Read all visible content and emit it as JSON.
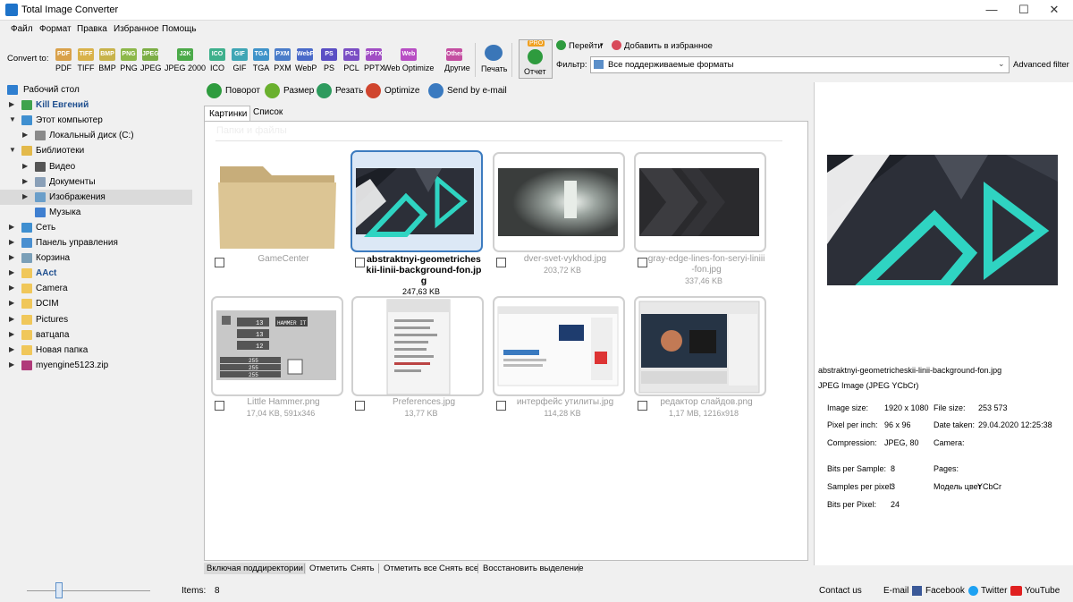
{
  "window": {
    "title": "Total Image Converter",
    "minimize": "—",
    "maximize": "☐",
    "close": "✕"
  },
  "menu": [
    "Файл",
    "Формат",
    "Правка",
    "Избранное",
    "Помощь"
  ],
  "toolbar": {
    "convert_to": "Convert to:",
    "formats": [
      {
        "label": "PDF",
        "icon": "PDF",
        "color": "#d9a14a"
      },
      {
        "label": "TIFF",
        "icon": "TIFF",
        "color": "#d9b24a"
      },
      {
        "label": "BMP",
        "icon": "BMP",
        "color": "#c8b34a"
      },
      {
        "label": "PNG",
        "icon": "PNG",
        "color": "#8db84a"
      },
      {
        "label": "JPEG",
        "icon": "JPEG",
        "color": "#7cae45"
      },
      {
        "label": "JPEG 2000",
        "icon": "J2K",
        "color": "#4caa4a"
      },
      {
        "label": "ICO",
        "icon": "ICO",
        "color": "#3eb08c"
      },
      {
        "label": "GIF",
        "icon": "GIF",
        "color": "#3fa6b5"
      },
      {
        "label": "TGA",
        "icon": "TGA",
        "color": "#3f93c9"
      },
      {
        "label": "PXM",
        "icon": "PXM",
        "color": "#4a7cc9"
      },
      {
        "label": "WebP",
        "icon": "WebP",
        "color": "#4a6ac9"
      },
      {
        "label": "PS",
        "icon": "PS",
        "color": "#5a4ec4"
      },
      {
        "label": "PCL",
        "icon": "PCL",
        "color": "#7a4ec4"
      },
      {
        "label": "PPTX",
        "icon": "PPTX",
        "color": "#a14ec4"
      },
      {
        "label": "Web Optimize",
        "icon": "Web",
        "color": "#b84ec4"
      },
      {
        "label": "Другие",
        "icon": "Other",
        "color": "#c44ea1"
      }
    ],
    "print": "Печать",
    "report": "Отчет",
    "pro": "PRO",
    "goto": "Перейти",
    "add_fav": "Добавить в избранное",
    "filter_label": "Фильтр:",
    "filter_value": "Все поддерживаемые форматы",
    "advanced_filter": "Advanced filter"
  },
  "tree": [
    {
      "label": "Рабочий стол",
      "color": "#2f7fd0",
      "indent": 0,
      "arrow": ""
    },
    {
      "label": "Kill Евгений",
      "color": "#3fa34d",
      "indent": 1,
      "arrow": "▶",
      "bold": true
    },
    {
      "label": "Этот компьютер",
      "color": "#3f8fd0",
      "indent": 1,
      "arrow": "▼"
    },
    {
      "label": "Локальный диск (C:)",
      "color": "#8a8a8a",
      "indent": 2,
      "arrow": "▶"
    },
    {
      "label": "Библиотеки",
      "color": "#e3b94a",
      "indent": 1,
      "arrow": "▼"
    },
    {
      "label": "Видео",
      "color": "#555",
      "indent": 2,
      "arrow": "▶"
    },
    {
      "label": "Документы",
      "color": "#8aa0b8",
      "indent": 2,
      "arrow": "▶"
    },
    {
      "label": "Изображения",
      "color": "#6a9ec9",
      "indent": 2,
      "arrow": "▶",
      "selected": true
    },
    {
      "label": "Музыка",
      "color": "#3f7fd0",
      "indent": 2,
      "arrow": ""
    },
    {
      "label": "Сеть",
      "color": "#3f8fd0",
      "indent": 1,
      "arrow": "▶"
    },
    {
      "label": "Панель управления",
      "color": "#4a8fd0",
      "indent": 1,
      "arrow": "▶"
    },
    {
      "label": "Корзина",
      "color": "#7a9fb8",
      "indent": 1,
      "arrow": "▶"
    },
    {
      "label": "AAct",
      "color": "#f0c75a",
      "indent": 1,
      "arrow": "▶",
      "bold": true,
      "blue": true
    },
    {
      "label": "Camera",
      "color": "#f0c75a",
      "indent": 1,
      "arrow": "▶"
    },
    {
      "label": "DCIM",
      "color": "#f0c75a",
      "indent": 1,
      "arrow": "▶"
    },
    {
      "label": "Pictures",
      "color": "#f0c75a",
      "indent": 1,
      "arrow": "▶"
    },
    {
      "label": "ватцапа",
      "color": "#f0c75a",
      "indent": 1,
      "arrow": "▶"
    },
    {
      "label": "Новая папка",
      "color": "#f0c75a",
      "indent": 1,
      "arrow": "▶"
    },
    {
      "label": "myengine5123.zip",
      "color": "#b03a7a",
      "indent": 1,
      "arrow": "▶"
    }
  ],
  "actions": [
    {
      "label": "Поворот",
      "color": "#2e9b3e"
    },
    {
      "label": "Размер",
      "color": "#6ab02e"
    },
    {
      "label": "Резать",
      "color": "#2e9b5e"
    },
    {
      "label": "Optimize",
      "color": "#d0452e"
    },
    {
      "label": "Send by e-mail",
      "color": "#3a7ac0"
    }
  ],
  "tabs": [
    "Картинки",
    "Список"
  ],
  "gallery_header": "Папки и файлы",
  "items": [
    {
      "name": "GameCenter",
      "size": "",
      "type": "folder"
    },
    {
      "name": "abstraktnyi-geometricheskii-linii-background-fon.jpg",
      "size": "247,63 KB",
      "type": "geo",
      "selected": true
    },
    {
      "name": "dver-svet-vykhod.jpg",
      "size": "203,72 KB",
      "type": "door"
    },
    {
      "name": "gray-edge-lines-fon-seryi-liniii-fon.jpg",
      "size": "337,46 KB",
      "type": "gray"
    },
    {
      "name": "Little Hammer.png",
      "size": "17,04 KB, 591x346",
      "type": "hammer"
    },
    {
      "name": "Preferences.jpg",
      "size": "13,77 KB",
      "type": "prefs"
    },
    {
      "name": "интерфейс утилиты.jpg",
      "size": "114,28 KB",
      "type": "ui"
    },
    {
      "name": "редактор слайдов.png",
      "size": "1,17 MB, 1216x918",
      "type": "slides"
    }
  ],
  "hammer_values": [
    "13",
    "13",
    "12",
    "255",
    "255",
    "255"
  ],
  "hammer_title": "HAMMER IT",
  "selection_bar": [
    "Включая поддиректории",
    "Отметить",
    "Снять",
    "Отметить все",
    "Снять все",
    "Восстановить выделение"
  ],
  "preview": {
    "filename": "abstraktnyi-geometricheskii-linii-background-fon.jpg",
    "format": "JPEG Image (JPEG YCbCr)",
    "rows": [
      {
        "k1": "Image size:",
        "v1": "1920 x 1080",
        "k2": "File size:",
        "v2": "253 573"
      },
      {
        "k1": "Pixel per inch:",
        "v1": "96 x 96",
        "k2": "Date taken:",
        "v2": "29.04.2020 12:25:38"
      },
      {
        "k1": "Compression:",
        "v1": "JPEG, 80",
        "k2": "Camera:",
        "v2": ""
      },
      {
        "k1": "Bits per Sample:",
        "v1": "8",
        "k2": "Pages:",
        "v2": ""
      },
      {
        "k1": "Samples per pixel:",
        "v1": "3",
        "k2": "Модель цвет",
        "v2": "YCbCr"
      },
      {
        "k1": "Bits per Pixel:",
        "v1": "24",
        "k2": "",
        "v2": ""
      }
    ]
  },
  "status": {
    "items_label": "Items:",
    "items_count": "8",
    "zoom_fraction": 0.25,
    "contact": "Contact us",
    "email": "E-mail",
    "facebook": "Facebook",
    "twitter": "Twitter",
    "youtube": "YouTube"
  }
}
